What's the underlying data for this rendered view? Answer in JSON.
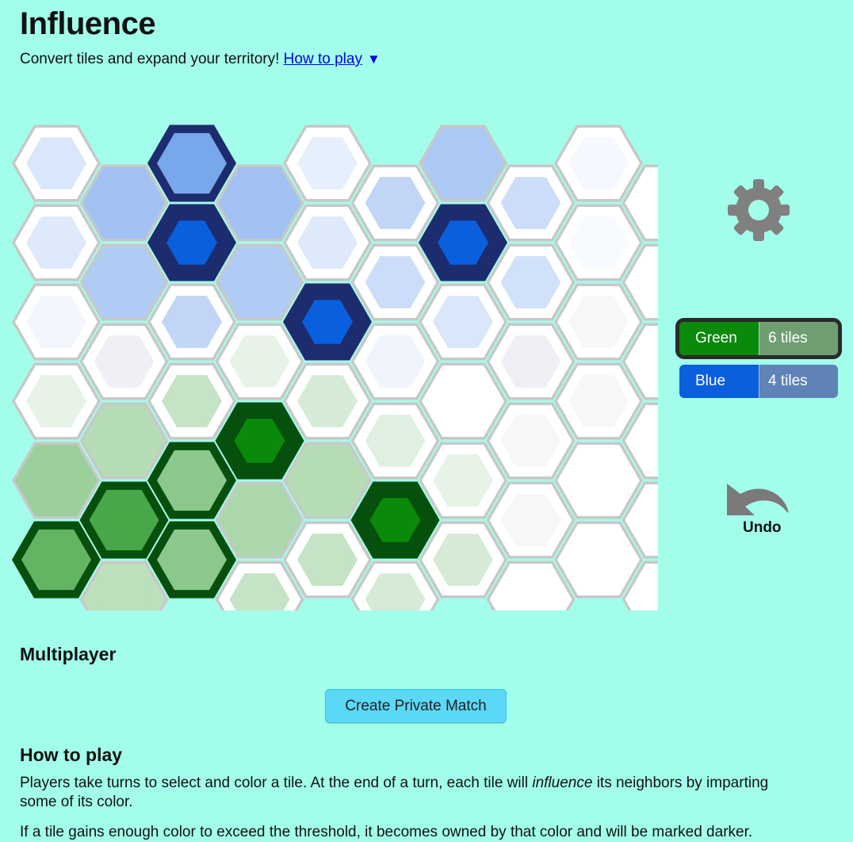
{
  "header": {
    "title": "Influence",
    "subtitle": "Convert tiles and expand your territory!",
    "how_to_play_link": "How to play",
    "toggle_icon": "▼"
  },
  "board": {
    "rows": 6,
    "cols": 10,
    "colors": {
      "empty_tile": "#ffffff",
      "tile_border": "#c8c8c8",
      "green_base": "#0a8a0a",
      "green_owned_border": "#064f0c",
      "blue_base": "#0a5fdd",
      "blue_owned_border": "#1d2c6e"
    },
    "tiles": [
      [
        {
          "side": "blue",
          "level": 0.18,
          "owned": false
        },
        {
          "side": "blue",
          "level": 0.45,
          "owned": false
        },
        {
          "side": "blue",
          "level": 0.65,
          "owned": true
        },
        {
          "side": "blue",
          "level": 0.45,
          "owned": false
        },
        {
          "side": "blue",
          "level": 0.12,
          "owned": false
        },
        {
          "side": "blue",
          "level": 0.3,
          "owned": false
        },
        {
          "side": "blue",
          "level": 0.4,
          "owned": false
        },
        {
          "side": "blue",
          "level": 0.25,
          "owned": false
        },
        {
          "side": "blue",
          "level": 0.05,
          "owned": false
        },
        {
          "side": "none",
          "level": 0,
          "owned": false
        }
      ],
      [
        {
          "side": "blue",
          "level": 0.16,
          "owned": false
        },
        {
          "side": "blue",
          "level": 0.38,
          "owned": false
        },
        {
          "side": "blue",
          "level": 1.0,
          "owned": true
        },
        {
          "side": "blue",
          "level": 0.38,
          "owned": false
        },
        {
          "side": "blue",
          "level": 0.16,
          "owned": false
        },
        {
          "side": "blue",
          "level": 0.25,
          "owned": false
        },
        {
          "side": "blue",
          "level": 1.0,
          "owned": true
        },
        {
          "side": "blue",
          "level": 0.22,
          "owned": false
        },
        {
          "side": "blue",
          "level": 0.04,
          "owned": false
        },
        {
          "side": "none",
          "level": 0,
          "owned": false
        }
      ],
      [
        {
          "side": "blue",
          "level": 0.06,
          "owned": false
        },
        {
          "side": "none",
          "level": 0.02,
          "owned": false
        },
        {
          "side": "blue",
          "level": 0.3,
          "owned": false
        },
        {
          "side": "green",
          "level": 0.12,
          "owned": false
        },
        {
          "side": "blue",
          "level": 1.0,
          "owned": true
        },
        {
          "side": "blue",
          "level": 0.07,
          "owned": false
        },
        {
          "side": "blue",
          "level": 0.18,
          "owned": false
        },
        {
          "side": "none",
          "level": 0.02,
          "owned": false
        },
        {
          "side": "none",
          "level": 0.01,
          "owned": false
        },
        {
          "side": "none",
          "level": 0,
          "owned": false
        }
      ],
      [
        {
          "side": "green",
          "level": 0.12,
          "owned": false
        },
        {
          "side": "green",
          "level": 0.35,
          "owned": false
        },
        {
          "side": "green",
          "level": 0.28,
          "owned": false
        },
        {
          "side": "green",
          "level": 1.0,
          "owned": true
        },
        {
          "side": "green",
          "level": 0.2,
          "owned": false
        },
        {
          "side": "green",
          "level": 0.15,
          "owned": false
        },
        {
          "side": "none",
          "level": 0,
          "owned": false
        },
        {
          "side": "none",
          "level": 0.01,
          "owned": false
        },
        {
          "side": "none",
          "level": 0.01,
          "owned": false
        },
        {
          "side": "none",
          "level": 0,
          "owned": false
        }
      ],
      [
        {
          "side": "green",
          "level": 0.48,
          "owned": false
        },
        {
          "side": "green",
          "level": 0.88,
          "owned": true
        },
        {
          "side": "green",
          "level": 0.55,
          "owned": true
        },
        {
          "side": "green",
          "level": 0.4,
          "owned": false
        },
        {
          "side": "green",
          "level": 0.35,
          "owned": false
        },
        {
          "side": "green",
          "level": 1.0,
          "owned": true
        },
        {
          "side": "green",
          "level": 0.12,
          "owned": false
        },
        {
          "side": "none",
          "level": 0.01,
          "owned": false
        },
        {
          "side": "none",
          "level": 0,
          "owned": false
        },
        {
          "side": "none",
          "level": 0,
          "owned": false
        }
      ],
      [
        {
          "side": "green",
          "level": 0.75,
          "owned": true
        },
        {
          "side": "green",
          "level": 0.32,
          "owned": false
        },
        {
          "side": "green",
          "level": 0.55,
          "owned": true
        },
        {
          "side": "green",
          "level": 0.28,
          "owned": false
        },
        {
          "side": "green",
          "level": 0.28,
          "owned": false
        },
        {
          "side": "green",
          "level": 0.2,
          "owned": false
        },
        {
          "side": "green",
          "level": 0.2,
          "owned": false
        },
        {
          "side": "none",
          "level": 0,
          "owned": false
        },
        {
          "side": "none",
          "level": 0,
          "owned": false
        },
        {
          "side": "none",
          "level": 0,
          "owned": false
        }
      ]
    ]
  },
  "settings": {
    "icon": "gear-icon",
    "color": "#808080"
  },
  "scores": [
    {
      "name": "Green",
      "count": "6 tiles",
      "name_bg": "#0a8a0a",
      "count_bg": "#6f9e72",
      "active": true
    },
    {
      "name": "Blue",
      "count": "4 tiles",
      "name_bg": "#0a5fdd",
      "count_bg": "#5f82b7",
      "active": false
    }
  ],
  "undo": {
    "label": "Undo",
    "icon": "undo-arrow-icon"
  },
  "multiplayer": {
    "heading": "Multiplayer",
    "create_button": "Create Private Match"
  },
  "how_to_play": {
    "heading": "How to play",
    "p1_before": "Players take turns to select and color a tile. At the end of a turn, each tile will",
    "p1_em": "influence",
    "p1_after": "its neighbors by imparting",
    "p1_line2": "some of its color.",
    "p2": "If a tile gains enough color to exceed the threshold, it becomes owned by that color and will be marked darker."
  }
}
